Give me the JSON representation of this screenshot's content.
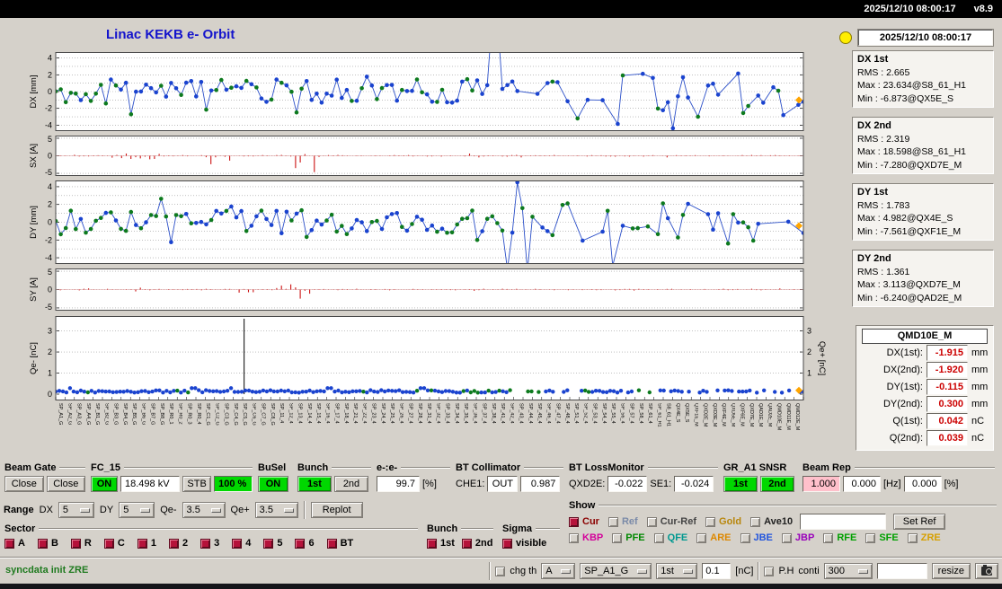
{
  "titlebar": {
    "clock": "2025/12/10 08:00:17",
    "version": "v8.9"
  },
  "header": {
    "title": "Linac KEKB e- Orbit",
    "timestamp": "2025/12/10 08:00:17",
    "led_color": "#ffee00"
  },
  "colors": {
    "accent_green": "#00d800",
    "alarm_red": "#cc0000",
    "pink": "#ffc0cb",
    "title_blue": "#1414cc",
    "point_blue": "#1a43cf",
    "point_green": "#0d7a1e",
    "steer_red": "#cc1111",
    "marker_orange": "#ffa500"
  },
  "stats_labels": {
    "rms": "RMS",
    "max": "Max",
    "min": "Min"
  },
  "stats": [
    {
      "name": "DX 1st",
      "rms": "2.665",
      "max": "23.634@S8_61_H1",
      "min": "-6.873@QX5E_S"
    },
    {
      "name": "DX 2nd",
      "rms": "2.319",
      "max": "18.598@S8_61_H1",
      "min": "-7.280@QXD7E_M"
    },
    {
      "name": "DY 1st",
      "rms": "1.783",
      "max": "4.982@QX4E_S",
      "min": "-7.561@QXF1E_M"
    },
    {
      "name": "DY 2nd",
      "rms": "1.361",
      "max": "3.113@QXD7E_M",
      "min": "-6.240@QAD2E_M"
    }
  ],
  "qmd": {
    "title": "QMD10E_M",
    "rows": [
      {
        "label": "DX(1st):",
        "value": "-1.915",
        "unit": "mm"
      },
      {
        "label": "DX(2nd):",
        "value": "-1.920",
        "unit": "mm"
      },
      {
        "label": "DY(1st):",
        "value": "-0.115",
        "unit": "mm"
      },
      {
        "label": "DY(2nd):",
        "value": "0.300",
        "unit": "mm"
      },
      {
        "label": "Q(1st):",
        "value": "0.042",
        "unit": "nC"
      },
      {
        "label": "Q(2nd):",
        "value": "0.039",
        "unit": "nC"
      }
    ]
  },
  "chart_data": [
    {
      "id": "dx",
      "type": "scatter-line",
      "ylabel": "DX [mm]",
      "ylim": [
        -4.6,
        4.6
      ],
      "yticks": [
        4,
        2,
        0,
        -2,
        -4
      ],
      "grid": [
        4,
        3,
        2,
        1,
        0,
        -1,
        -2,
        -3,
        -4
      ],
      "n": 150,
      "seed": 11,
      "amp": 1.5,
      "spikes": [
        {
          "at": 0.585,
          "v": 9
        },
        {
          "at": 0.59,
          "v": 9
        }
      ],
      "dips": [
        {
          "at": 0.7,
          "v": -3.2
        },
        {
          "at": 0.86,
          "v": -3.0
        },
        {
          "at": 0.97,
          "v": -2.8
        }
      ],
      "marker": {
        "v": -1,
        "color": "#ffa500"
      }
    },
    {
      "id": "sx",
      "type": "bars",
      "ylabel": "SX [A]",
      "ylim": [
        -5.5,
        5.5
      ],
      "yticks": [
        5,
        0,
        -5
      ],
      "grid": [
        5,
        0,
        -5
      ],
      "n": 160,
      "seed": 22,
      "amp": 0.25,
      "clusters": [
        {
          "from": 0.08,
          "to": 0.14,
          "amp": 1.0
        },
        {
          "from": 0.2,
          "to": 0.235,
          "amp": 1.4
        },
        {
          "from": 0.315,
          "to": 0.355,
          "amp": 3.8
        },
        {
          "from": 0.55,
          "to": 0.57,
          "amp": 0.8
        }
      ]
    },
    {
      "id": "dy",
      "type": "scatter-line",
      "ylabel": "DY [mm]",
      "ylim": [
        -4.6,
        4.6
      ],
      "yticks": [
        4,
        2,
        0,
        -2,
        -4
      ],
      "grid": [
        4,
        3,
        2,
        1,
        0,
        -1,
        -2,
        -3,
        -4
      ],
      "n": 150,
      "seed": 33,
      "amp": 1.4,
      "spikes": [
        {
          "at": 0.617,
          "v": 4.5
        }
      ],
      "dips": [
        {
          "at": 0.605,
          "v": -5.3
        },
        {
          "at": 0.632,
          "v": -5.5
        },
        {
          "at": 0.744,
          "v": -4.9
        },
        {
          "at": 0.8,
          "v": -2.7
        },
        {
          "at": 0.9,
          "v": -2.4
        }
      ],
      "marker": {
        "v": -0.4,
        "color": "#ffa500"
      }
    },
    {
      "id": "sy",
      "type": "bars",
      "ylabel": "SY [A]",
      "ylim": [
        -5.5,
        5.5
      ],
      "yticks": [
        5,
        0,
        -5
      ],
      "grid": [
        5,
        0,
        -5
      ],
      "n": 160,
      "seed": 44,
      "amp": 0.22,
      "clusters": [
        {
          "from": 0.1,
          "to": 0.12,
          "amp": 0.8
        },
        {
          "from": 0.24,
          "to": 0.27,
          "amp": 1.2
        },
        {
          "from": 0.3,
          "to": 0.345,
          "amp": 3.5
        }
      ]
    },
    {
      "id": "q",
      "type": "dots",
      "ylabel": "Qe- [nC]",
      "ylabelRight": "Qe+ [nC]",
      "ylim": [
        0,
        3.45
      ],
      "yticks": [
        3,
        2,
        1,
        0
      ],
      "rightTicks": [
        3,
        2,
        1
      ],
      "grid": [
        3,
        2,
        1
      ],
      "n": 210,
      "seed": 55,
      "level": 0.13,
      "vline": 0.252,
      "marker": {
        "v": 0.18,
        "color": "#ffa500"
      }
    }
  ],
  "bpm_labels": [
    "SP_A1_G",
    "SP_A2_G",
    "SP_A3_G",
    "SP_A4_G",
    "SP_B1_G",
    "SP_B2_G",
    "SP_B3_G",
    "SP_B4_G",
    "SP_B5_G",
    "SP_B6_G",
    "SP_B7_G",
    "SP_B8_G",
    "SP_R0_1",
    "SP_R0_2",
    "SP_R0_3",
    "SP_R0_4",
    "SP_C1_G",
    "SP_C2_G",
    "SP_C3_G",
    "SP_C4_G",
    "SP_C5_G",
    "SP_C6_G",
    "SP_C7_G",
    "SP_C8_G",
    "SP_11_4",
    "SP_12_4",
    "SP_13_4",
    "SP_14_4",
    "SP_15_4",
    "SP_16_4",
    "SP_17_4",
    "SP_18_4",
    "SP_21_4",
    "SP_22_4",
    "SP_23_4",
    "SP_24_4",
    "SP_25_4",
    "SP_26_4",
    "SP_27_4",
    "SP_28_4",
    "SP_31_4",
    "SP_32_4",
    "SP_33_4",
    "SP_34_4",
    "SP_35_4",
    "SP_36_4",
    "SP_37_4",
    "SP_38_4",
    "SP_41_4",
    "SP_42_4",
    "SP_43_4",
    "SP_44_4",
    "SP_45_4",
    "SP_46_4",
    "SP_47_4",
    "SP_48_4",
    "SP_51_4",
    "SP_52_4",
    "SP_53_4",
    "SP_54_4",
    "SP_55_4",
    "SP_56_4",
    "SP_57_4",
    "SP_58_4",
    "SP_61_4",
    "SP_61_H1",
    "S8_61_H1",
    "QX4E_S",
    "QX5E_S",
    "QXF1E_M",
    "QXD2E_M",
    "QXD3E_M",
    "QXF4E_M",
    "QXD5E_M",
    "QXF6E_M",
    "QXD7E_M",
    "QAD1E_M",
    "QAD2E_M",
    "QMD10E_M",
    "QMD11E_M",
    "QMD12E_M"
  ],
  "controls": {
    "beam_gate": {
      "label": "Beam Gate",
      "buttons": [
        "Close",
        "Close"
      ]
    },
    "fc15": {
      "label": "FC_15",
      "on": "ON",
      "kv": "18.498 kV",
      "stb": "STB",
      "pct": "100 %"
    },
    "busel": {
      "label": "BuSel",
      "on": "ON"
    },
    "bunch": {
      "label": "Bunch",
      "b1": "1st",
      "b2": "2nd"
    },
    "ee": {
      "label": "e-:e-",
      "value": "99.7",
      "unit": "[%]"
    },
    "bt_coll": {
      "label": "BT Collimator",
      "che1": "CHE1:",
      "out": "OUT",
      "value": "0.987"
    },
    "bt_loss": {
      "label": "BT LossMonitor",
      "qxd2e_label": "QXD2E:",
      "qxd2e": "-0.022",
      "se1_label": "SE1:",
      "se1": "-0.024"
    },
    "gr_snsr": {
      "label": "GR_A1 SNSR",
      "b1": "1st",
      "b2": "2nd"
    },
    "beam_rep": {
      "label": "Beam Rep",
      "v1": "1.000",
      "v2": "0.000",
      "hz": "[Hz]",
      "v3": "0.000",
      "pct": "[%]"
    },
    "range": {
      "label": "Range",
      "dx_label": "DX",
      "dx": "5",
      "dy_label": "DY",
      "dy": "5",
      "qem_label": "Qe-",
      "qem": "3.5",
      "qep_label": "Qe+",
      "qep": "3.5",
      "replot": "Replot"
    },
    "sector": {
      "label": "Sector",
      "items": [
        "A",
        "B",
        "R",
        "C",
        "1",
        "2",
        "3",
        "4",
        "5",
        "6",
        "BT"
      ]
    },
    "bunch2": {
      "label": "Bunch",
      "items": [
        "1st",
        "2nd"
      ]
    },
    "sigma": {
      "label": "Sigma",
      "items": [
        "visible"
      ]
    },
    "show": {
      "label": "Show",
      "set_ref": "Set Ref",
      "input_value": "",
      "row1": [
        {
          "label": "Cur",
          "color": "#8b0000",
          "checked": true
        },
        {
          "label": "Ref",
          "color": "#7a8aa8",
          "checked": false
        },
        {
          "label": "Cur-Ref",
          "color": "#444444",
          "checked": false
        },
        {
          "label": "Gold",
          "color": "#b8860b",
          "checked": false
        },
        {
          "label": "Ave10",
          "color": "#222222",
          "checked": false
        }
      ],
      "row2": [
        {
          "label": "KBP",
          "color": "#d4009a",
          "checked": false
        },
        {
          "label": "PFE",
          "color": "#008800",
          "checked": false
        },
        {
          "label": "QFE",
          "color": "#009890",
          "checked": false
        },
        {
          "label": "ARE",
          "color": "#dd8800",
          "checked": false
        },
        {
          "label": "JBE",
          "color": "#2255dd",
          "checked": false
        },
        {
          "label": "JBP",
          "color": "#9900bb",
          "checked": false
        },
        {
          "label": "RFE",
          "color": "#00a000",
          "checked": false
        },
        {
          "label": "SFE",
          "color": "#00a000",
          "checked": false
        },
        {
          "label": "ZRE",
          "color": "#d6a000",
          "checked": false
        }
      ]
    }
  },
  "statusbar": {
    "message": "syncdata init ZRE",
    "chg_th": "chg th",
    "sel_a": "A",
    "sel_sp": "SP_A1_G",
    "sel_1st": "1st",
    "th_value": "0.1",
    "nc": "[nC]",
    "ph": "P.H",
    "conti": "conti",
    "rep": "300",
    "blank": "",
    "resize": "resize"
  }
}
